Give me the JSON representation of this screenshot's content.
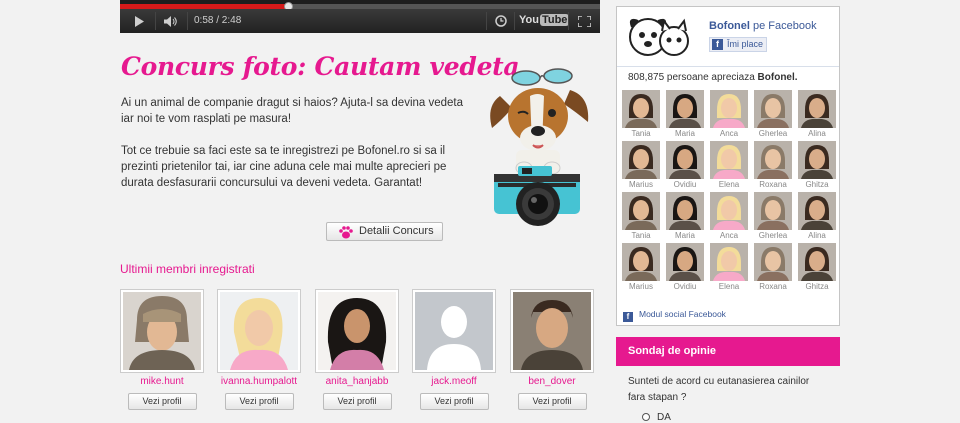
{
  "player": {
    "time": "0:58 / 2:48",
    "progress_fraction": 0.35,
    "logo_you": "You",
    "logo_tube": "Tube"
  },
  "contest": {
    "title": "Concurs foto: Cautam vedeta",
    "paragraph1": "Ai un animal de companie dragut si haios? Ajuta-l sa devina vedeta iar noi te vom rasplati pe masura!",
    "paragraph2": "Tot ce trebuie sa faci este sa te inregistrezi pe Bofonel.ro si sa il prezinti prietenilor tai, iar cine aduna cele mai multe aprecieri pe durata desfasurarii concursului va deveni vedeta. Garantat!",
    "details_button": "Detalii Concurs"
  },
  "members": {
    "title": "Ultimii membri inregistrati",
    "profile_button": "Vezi profil",
    "list": [
      {
        "username": "mike.hunt"
      },
      {
        "username": "ivanna.humpalott"
      },
      {
        "username": "anita_hanjabb"
      },
      {
        "username": "jack.meoff"
      },
      {
        "username": "ben_dover"
      }
    ]
  },
  "facebook": {
    "page_name": "Bofonel",
    "on_facebook": "pe Facebook",
    "like_button": "Îmi place",
    "like_icon": "f",
    "fan_count_text": "808,875 persoane apreciaza",
    "fan_count_name": "Bofonel.",
    "fans": [
      "Tania",
      "Maria",
      "Anca",
      "Gherlea",
      "Alina",
      "Marius",
      "Ovidiu",
      "Elena",
      "Roxana",
      "Ghitza",
      "Tania",
      "Maria",
      "Anca",
      "Gherlea",
      "Alina",
      "Marius",
      "Ovidiu",
      "Elena",
      "Roxana",
      "Ghitza"
    ],
    "footer": "Modul social Facebook"
  },
  "poll": {
    "title": "Sondaj de opinie",
    "question": "Sunteti de acord cu eutanasierea cainilor fara stapan ?",
    "option1": "DA"
  },
  "colors": {
    "accent": "#e6198f",
    "facebook_blue": "#3b5998"
  }
}
